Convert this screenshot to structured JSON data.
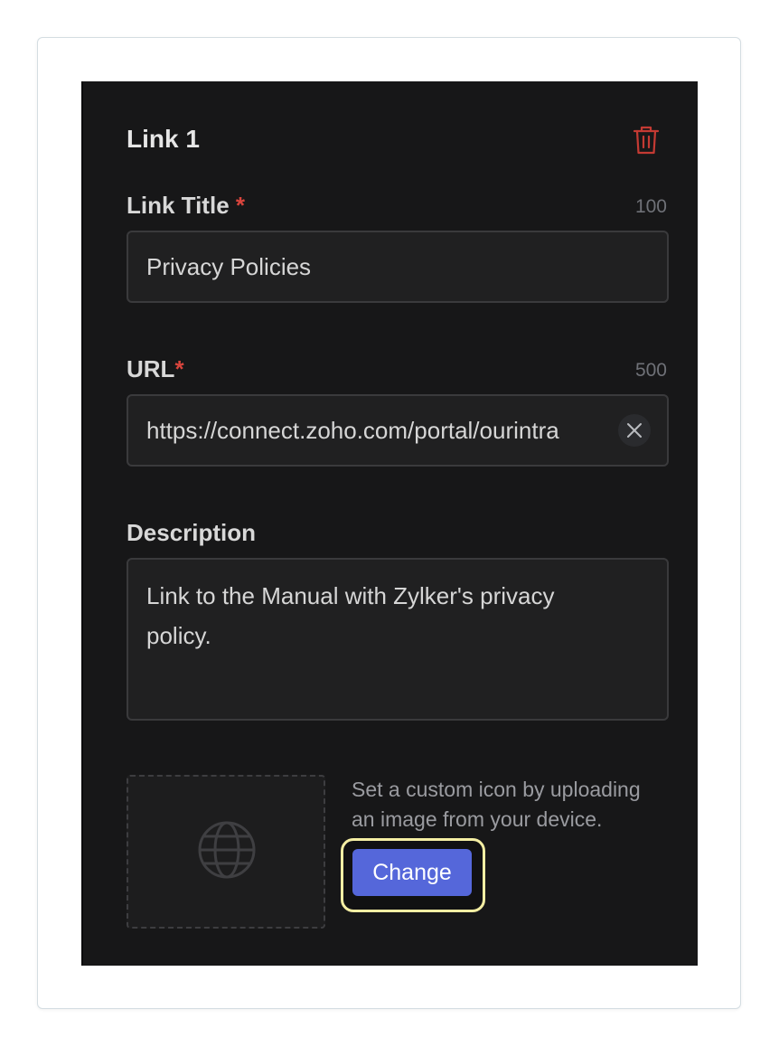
{
  "card": {
    "title": "Link 1",
    "delete_icon": "trash-icon"
  },
  "link_title": {
    "label": "Link Title",
    "required_mark": "*",
    "counter": "100",
    "value": "Privacy Policies"
  },
  "url": {
    "label": "URL",
    "required_mark": "*",
    "counter": "500",
    "value": "https://connect.zoho.com/portal/ourintra",
    "clear_icon": "close-icon"
  },
  "description": {
    "label": "Description",
    "value": "Link to the Manual with Zylker's privacy policy."
  },
  "custom_icon": {
    "preview_icon": "globe-icon",
    "hint": "Set a custom icon by uploading an image from your device.",
    "change_label": "Change"
  },
  "colors": {
    "panel_bg": "#171718",
    "required": "#d9453d",
    "delete": "#c43a33",
    "button": "#5567da",
    "highlight": "#f4eea3"
  }
}
